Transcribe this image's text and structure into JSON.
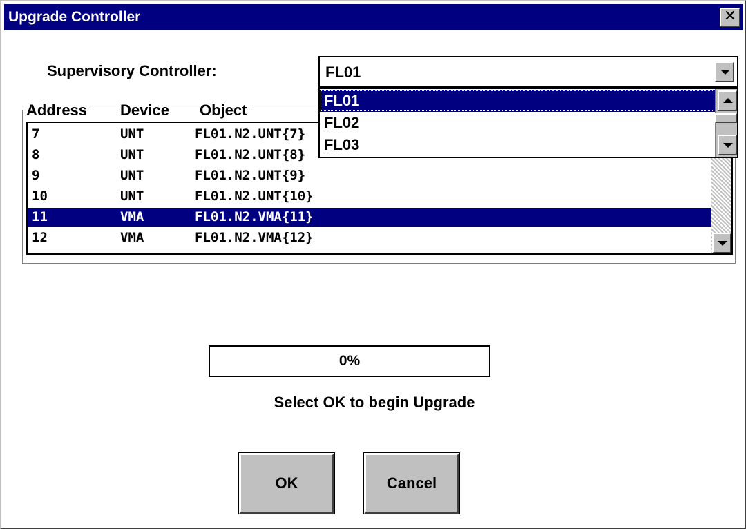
{
  "window": {
    "title": "Upgrade Controller",
    "close_glyph": "✕"
  },
  "supervisory": {
    "label": "Supervisory Controller:",
    "value": "FL01",
    "options": [
      "FL01",
      "FL02",
      "FL03"
    ],
    "selected_option": "FL01"
  },
  "list": {
    "headers": {
      "address": "Address",
      "device": "Device",
      "object": "Object"
    },
    "rows": [
      {
        "address": "7",
        "device": "UNT",
        "object": "FL01.N2.UNT{7}",
        "selected": false
      },
      {
        "address": "8",
        "device": "UNT",
        "object": "FL01.N2.UNT{8}",
        "selected": false
      },
      {
        "address": "9",
        "device": "UNT",
        "object": "FL01.N2.UNT{9}",
        "selected": false
      },
      {
        "address": "10",
        "device": "UNT",
        "object": "FL01.N2.UNT{10}",
        "selected": false
      },
      {
        "address": "11",
        "device": "VMA",
        "object": "FL01.N2.VMA{11}",
        "selected": true
      },
      {
        "address": "12",
        "device": "VMA",
        "object": "FL01.N2.VMA{12}",
        "selected": false
      }
    ]
  },
  "progress": {
    "text": "0%",
    "fraction": 0
  },
  "status_message": "Select OK to begin Upgrade",
  "buttons": {
    "ok": "OK",
    "cancel": "Cancel"
  },
  "icons": {
    "close": "close-icon",
    "combo_arrow": "chevron-down-icon",
    "scroll_up": "scroll-up-icon",
    "scroll_down": "scroll-down-icon"
  },
  "colors": {
    "titlebar": "#000080",
    "selection": "#000080",
    "face": "#c0c0c0",
    "background": "#ffffff"
  }
}
